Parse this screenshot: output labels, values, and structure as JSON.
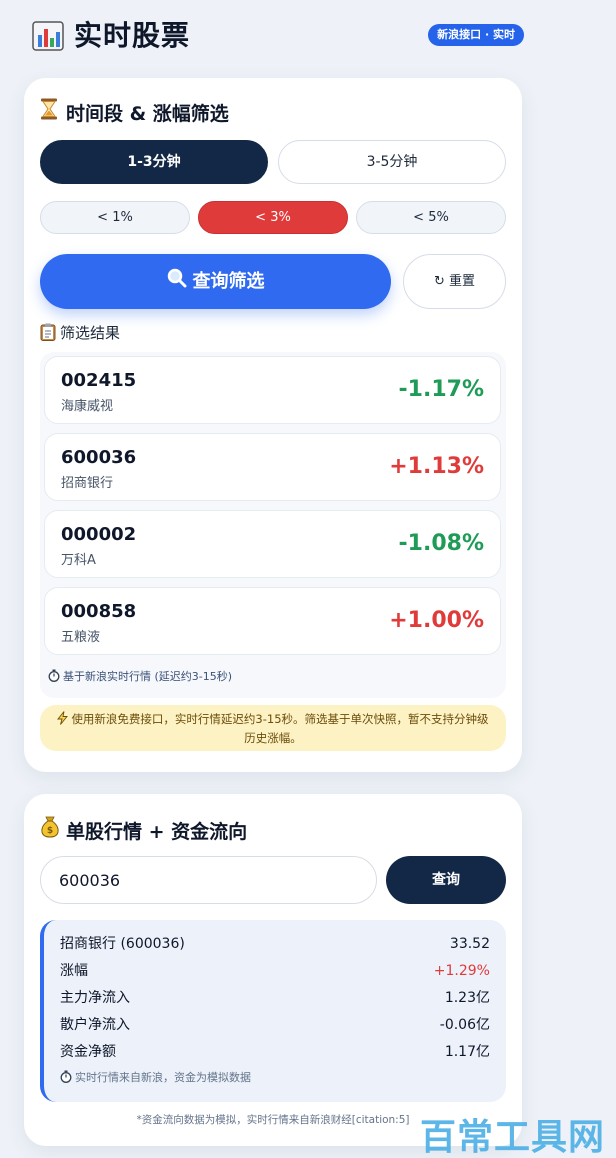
{
  "header": {
    "title": "实时股票",
    "api_badge": "新浪接口 · 实时"
  },
  "filter": {
    "title": "时间段 & 涨幅筛选",
    "periods": [
      {
        "label": "1-3分钟",
        "active": true
      },
      {
        "label": "3-5分钟",
        "active": false
      }
    ],
    "thresholds": [
      {
        "label": "< 1%",
        "active": false
      },
      {
        "label": "< 3%",
        "active": true
      },
      {
        "label": "< 5%",
        "active": false
      }
    ],
    "query_label": "查询筛选",
    "reset_label": "↻ 重置",
    "results_label": "筛选结果",
    "results": [
      {
        "code": "002415",
        "name": "海康威视",
        "change": "-1.17%",
        "direction": "down"
      },
      {
        "code": "600036",
        "name": "招商银行",
        "change": "+1.13%",
        "direction": "up"
      },
      {
        "code": "000002",
        "name": "万科A",
        "change": "-1.08%",
        "direction": "down"
      },
      {
        "code": "000858",
        "name": "五粮液",
        "change": "+1.00%",
        "direction": "up"
      }
    ],
    "results_note": "基于新浪实时行情 (延迟约3-15秒)",
    "warning": "使用新浪免费接口，实时行情延迟约3-15秒。筛选基于单次快照，暂不支持分钟级历史涨幅。"
  },
  "quote": {
    "title": "单股行情 + 资金流向",
    "input_value": "600036",
    "query_label": "查询",
    "rows": [
      {
        "label": "招商银行 (600036)",
        "value": "33.52",
        "color": "#0f172a"
      },
      {
        "label": "涨幅",
        "value": "+1.29%",
        "color": "#e03b3b"
      },
      {
        "label": "主力净流入",
        "value": "1.23亿",
        "color": "#0f172a"
      },
      {
        "label": "散户净流入",
        "value": "-0.06亿",
        "color": "#0f172a"
      },
      {
        "label": "资金净额",
        "value": "1.17亿",
        "color": "#0f172a"
      }
    ],
    "note": "实时行情来自新浪，资金为模拟数据",
    "footnote": "*资金流向数据为模拟，实时行情来自新浪财经[citation:5]"
  },
  "colors": {
    "up": "#e03b3b",
    "down": "#1e9b57",
    "accent": "#2f6af0",
    "navy": "#132847"
  },
  "icons": {
    "app": "bar-chart-icon",
    "filter": "hourglass-icon",
    "query": "magnifier-icon",
    "results": "clipboard-icon",
    "timer": "stopwatch-icon",
    "warning": "lightning-icon",
    "quote": "money-bag-icon"
  },
  "watermark": "百常工具网"
}
